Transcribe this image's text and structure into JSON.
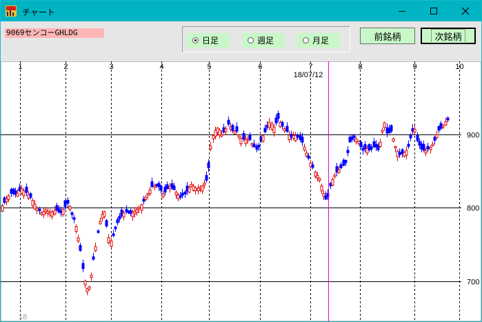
{
  "window": {
    "title": "チャート"
  },
  "toolbar": {
    "ticker": "9069センコーGHLDG",
    "periods": [
      {
        "label": "日足",
        "selected": true
      },
      {
        "label": "週足",
        "selected": false
      },
      {
        "label": "月足",
        "selected": false
      }
    ],
    "prev_label": "前銘柄",
    "next_label": "次銘柄"
  },
  "colors": {
    "up_candle": "#e00000",
    "down_candle": "#0000ff",
    "cursor_line": "#e000e0",
    "titlebar": "#00b4c4",
    "button_bg": "#c8f8c8"
  },
  "chart_data": {
    "type": "candlestick",
    "cursor_date": "18/07/12",
    "month_labels": [
      "1",
      "2",
      "3",
      "4",
      "5",
      "6",
      "7",
      "8",
      "9",
      "10"
    ],
    "year_label": "18",
    "price_levels": [
      700,
      800,
      900
    ],
    "ylim": [
      645,
      1000
    ],
    "close_path": [
      [
        0,
        800
      ],
      [
        5,
        807
      ],
      [
        10,
        815
      ],
      [
        15,
        820
      ],
      [
        22,
        818
      ],
      [
        30,
        826
      ],
      [
        38,
        820
      ],
      [
        45,
        812
      ],
      [
        52,
        800
      ],
      [
        58,
        793
      ],
      [
        65,
        797
      ],
      [
        72,
        793
      ],
      [
        80,
        798
      ],
      [
        86,
        792
      ],
      [
        92,
        800
      ],
      [
        98,
        808
      ],
      [
        103,
        790
      ],
      [
        108,
        780
      ],
      [
        112,
        760
      ],
      [
        115,
        745
      ],
      [
        118,
        720
      ],
      [
        121,
        703
      ],
      [
        124,
        690
      ],
      [
        127,
        688
      ],
      [
        130,
        700
      ],
      [
        134,
        728
      ],
      [
        138,
        750
      ],
      [
        142,
        775
      ],
      [
        146,
        790
      ],
      [
        150,
        795
      ],
      [
        154,
        770
      ],
      [
        158,
        752
      ],
      [
        162,
        760
      ],
      [
        168,
        778
      ],
      [
        174,
        788
      ],
      [
        180,
        795
      ],
      [
        188,
        792
      ],
      [
        196,
        796
      ],
      [
        205,
        806
      ],
      [
        212,
        818
      ],
      [
        220,
        830
      ],
      [
        228,
        830
      ],
      [
        236,
        818
      ],
      [
        244,
        830
      ],
      [
        252,
        824
      ],
      [
        260,
        814
      ],
      [
        268,
        820
      ],
      [
        276,
        832
      ],
      [
        284,
        826
      ],
      [
        292,
        830
      ],
      [
        300,
        840
      ],
      [
        303,
        875
      ],
      [
        306,
        895
      ],
      [
        310,
        905
      ],
      [
        315,
        910
      ],
      [
        320,
        900
      ],
      [
        325,
        905
      ],
      [
        330,
        915
      ],
      [
        336,
        905
      ],
      [
        342,
        905
      ],
      [
        348,
        895
      ],
      [
        354,
        893
      ],
      [
        360,
        895
      ],
      [
        366,
        885
      ],
      [
        372,
        878
      ],
      [
        378,
        895
      ],
      [
        384,
        905
      ],
      [
        390,
        918
      ],
      [
        396,
        910
      ],
      [
        402,
        922
      ],
      [
        408,
        912
      ],
      [
        414,
        905
      ],
      [
        420,
        896
      ],
      [
        426,
        900
      ],
      [
        432,
        895
      ],
      [
        438,
        888
      ],
      [
        444,
        872
      ],
      [
        450,
        860
      ],
      [
        456,
        848
      ],
      [
        462,
        840
      ],
      [
        468,
        820
      ],
      [
        473,
        808
      ],
      [
        477,
        828
      ],
      [
        482,
        842
      ],
      [
        488,
        850
      ],
      [
        494,
        855
      ],
      [
        500,
        862
      ],
      [
        506,
        890
      ],
      [
        512,
        896
      ],
      [
        518,
        892
      ],
      [
        524,
        878
      ],
      [
        530,
        882
      ],
      [
        536,
        878
      ],
      [
        542,
        885
      ],
      [
        548,
        878
      ],
      [
        552,
        900
      ],
      [
        556,
        918
      ],
      [
        560,
        900
      ],
      [
        566,
        905
      ],
      [
        572,
        884
      ],
      [
        578,
        872
      ],
      [
        584,
        875
      ],
      [
        590,
        880
      ],
      [
        596,
        902
      ],
      [
        600,
        910
      ],
      [
        604,
        890
      ],
      [
        610,
        880
      ],
      [
        616,
        878
      ],
      [
        622,
        882
      ],
      [
        628,
        890
      ],
      [
        634,
        905
      ],
      [
        640,
        910
      ],
      [
        646,
        920
      ]
    ]
  }
}
